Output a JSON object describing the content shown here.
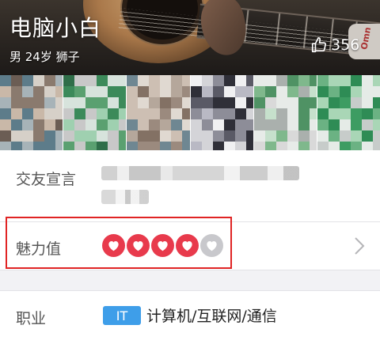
{
  "profile": {
    "name": "电脑小白",
    "meta": "男 24岁 狮子",
    "likes": "356",
    "brand_mark": "Omn"
  },
  "photos": {
    "count": 6
  },
  "info": {
    "declaration_label": "交友宣言",
    "declaration_text": "",
    "charm_label": "魅力值",
    "charm_rating": {
      "filled": 4,
      "total": 5
    },
    "occupation_label": "职业",
    "occupation_badge": "IT",
    "occupation_value": "计算机/互联网/通信"
  },
  "colors": {
    "heart": "#e83a4c",
    "heart_empty": "#c8c8cc",
    "badge": "#3e9ee9",
    "highlight": "#e02424"
  },
  "icons": {
    "likes": "thumbs-up-icon",
    "chevron": "chevron-right-icon",
    "heart": "heart-icon"
  }
}
